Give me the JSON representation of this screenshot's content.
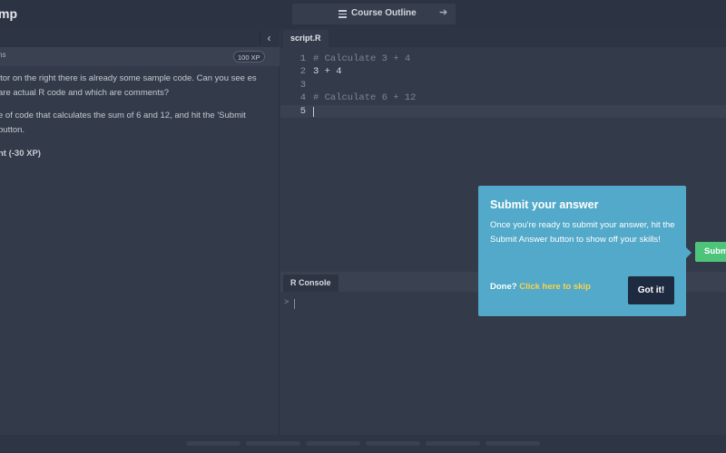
{
  "header": {
    "brand": "mp",
    "course_outline_label": "Course Outline",
    "hamburger_icon": "hamburger-icon",
    "next_icon": "arrow-right-icon"
  },
  "left_pane": {
    "collapse_icon": "chevron-left-icon",
    "tab_fragment": "ns",
    "xp_badge": "100 XP",
    "instructions": [
      "itor on the right there is already some sample code. Can you see es are actual R code and which are comments?",
      "e of code that calculates the sum of 6 and 12, and hit the 'Submit button."
    ],
    "hint": "nt (-30 XP)"
  },
  "editor": {
    "tab_label": "script.R",
    "lines": [
      {
        "num": "1",
        "text": "# Calculate 3 + 4",
        "kind": "comment"
      },
      {
        "num": "2",
        "text": "3 + 4",
        "kind": "code"
      },
      {
        "num": "3",
        "text": "",
        "kind": "code"
      },
      {
        "num": "4",
        "text": "# Calculate 6 + 12",
        "kind": "comment"
      },
      {
        "num": "5",
        "text": "",
        "kind": "code"
      }
    ]
  },
  "console": {
    "tab_label": "R Console",
    "prompt": ">"
  },
  "popover": {
    "title": "Submit your answer",
    "body": "Once you're ready to submit your answer, hit the Submit Answer button to show off your skills!",
    "done_label": "Done?",
    "skip_link": "Click here to skip",
    "got_it_button": "Got it!"
  },
  "submit_button": "Subm",
  "colors": {
    "background": "#333b4a",
    "popover": "#52a9c9",
    "got_it": "#1e2a40",
    "skip_link": "#fbd24e",
    "submit": "#4ec47a"
  }
}
